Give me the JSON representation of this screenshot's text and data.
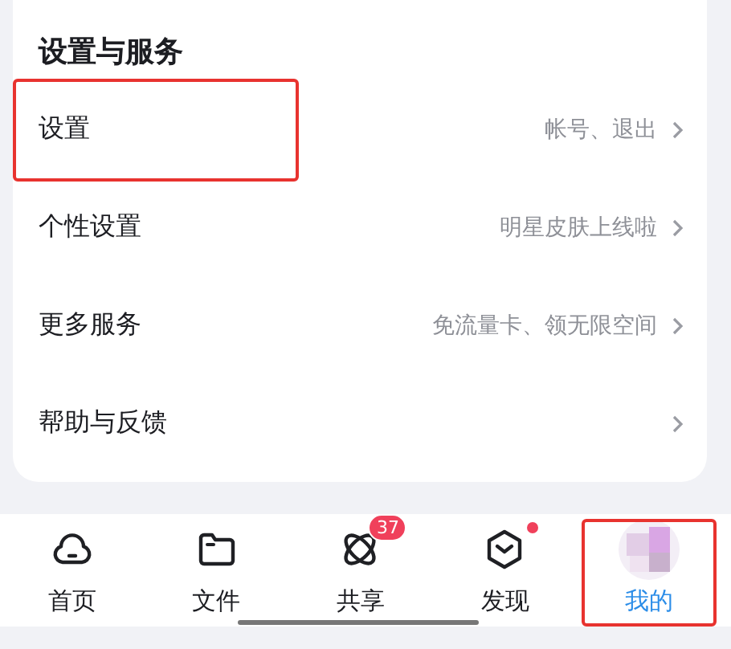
{
  "section": {
    "title": "设置与服务",
    "rows": [
      {
        "label": "设置",
        "hint": "帐号、退出",
        "highlighted": true
      },
      {
        "label": "个性设置",
        "hint": "明星皮肤上线啦",
        "highlighted": false
      },
      {
        "label": "更多服务",
        "hint": "免流量卡、领无限空间",
        "highlighted": false
      },
      {
        "label": "帮助与反馈",
        "highlighted": false
      }
    ]
  },
  "tab_bar": [
    {
      "kind": "cloud",
      "label": "首页",
      "selected": false,
      "highlighted": false
    },
    {
      "kind": "folder",
      "label": "文件",
      "selected": false,
      "highlighted": false
    },
    {
      "kind": "orbit",
      "label": "共享",
      "selected": false,
      "highlighted": false,
      "badge": "37"
    },
    {
      "kind": "hexagon",
      "label": "发现",
      "selected": false,
      "highlighted": false,
      "dot": true
    },
    {
      "kind": "avatar",
      "label": "我的",
      "selected": true,
      "highlighted": true
    }
  ]
}
